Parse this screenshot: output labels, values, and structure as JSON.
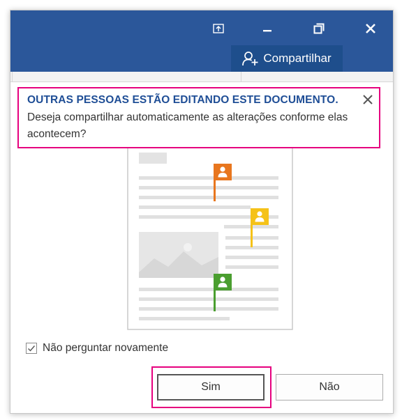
{
  "titlebar": {
    "bg_color": "#2b579a",
    "buttons": [
      {
        "name": "ribbon-display-options-icon"
      },
      {
        "name": "minimize-icon"
      },
      {
        "name": "restore-icon"
      },
      {
        "name": "close-icon"
      }
    ]
  },
  "share": {
    "label": "Compartilhar",
    "icon": "add-person-icon"
  },
  "notice": {
    "title": "OUTRAS PESSOAS ESTÃO EDITANDO ESTE DOCUMENTO.",
    "message": "Deseja compartilhar automaticamente as alterações conforme elas acontecem?",
    "highlight_color": "#e6007e",
    "title_color": "#1f4e96"
  },
  "illustration": {
    "flag_colors": [
      "#e8761e",
      "#f5c218",
      "#4a9e2f"
    ]
  },
  "dont_ask": {
    "label": "Não perguntar novamente",
    "checked": true
  },
  "buttons": {
    "yes_label": "Sim",
    "no_label": "Não"
  }
}
